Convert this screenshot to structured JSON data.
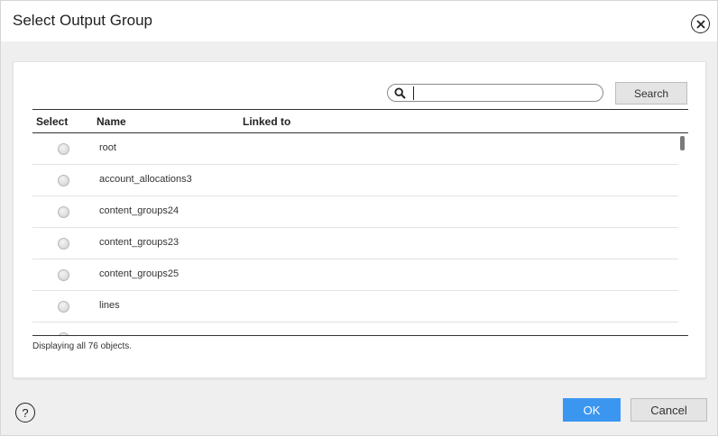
{
  "dialog": {
    "title": "Select Output Group"
  },
  "search": {
    "placeholder": "",
    "value": "",
    "button_label": "Search"
  },
  "table": {
    "columns": [
      "Select",
      "Name",
      "Linked to"
    ],
    "rows": [
      {
        "name": "root",
        "linked_to": ""
      },
      {
        "name": "account_allocations3",
        "linked_to": ""
      },
      {
        "name": "content_groups24",
        "linked_to": ""
      },
      {
        "name": "content_groups23",
        "linked_to": ""
      },
      {
        "name": "content_groups25",
        "linked_to": ""
      },
      {
        "name": "lines",
        "linked_to": ""
      }
    ]
  },
  "status": {
    "text": "Displaying all 76 objects."
  },
  "footer": {
    "help_glyph": "?",
    "ok_label": "OK",
    "cancel_label": "Cancel"
  },
  "colors": {
    "accent": "#3b96f0",
    "background": "#efefef"
  },
  "icons": [
    "close-icon",
    "search-icon",
    "help-icon"
  ]
}
